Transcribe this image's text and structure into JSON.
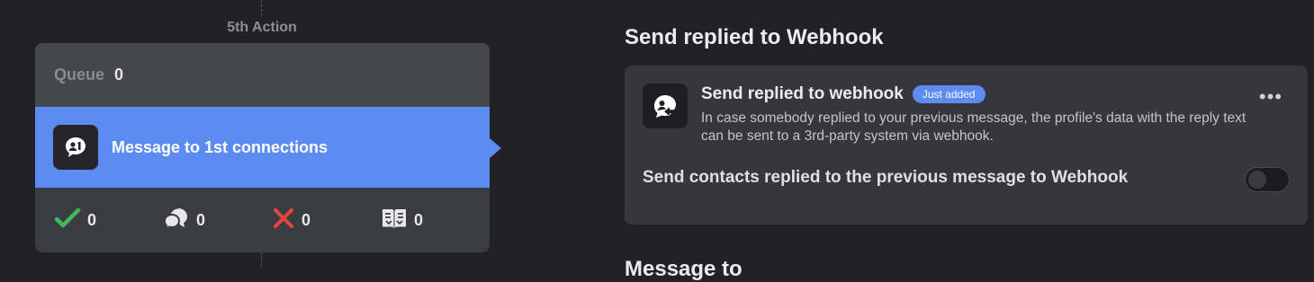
{
  "flow": {
    "action_label": "5th Action",
    "queue_label": "Queue",
    "queue_count": "0",
    "message_title": "Message to 1st connections",
    "stats": {
      "accepted": "0",
      "replied": "0",
      "failed": "0",
      "skipped": "0"
    }
  },
  "panel": {
    "section_title": "Send replied to Webhook",
    "card": {
      "title": "Send replied to webhook",
      "badge": "Just added",
      "description": "In case somebody replied to your previous message, the profile's data with the reply text can be sent to a 3rd-party system via webhook.",
      "more_icon": "more-dots-icon",
      "toggle_label": "Send contacts replied to the previous message to Webhook",
      "toggle_on": false
    },
    "next_section_title": "Message to"
  },
  "colors": {
    "accent": "#5c8cf2",
    "success": "#3dbb5a",
    "danger": "#e8453c",
    "background": "#222226"
  }
}
